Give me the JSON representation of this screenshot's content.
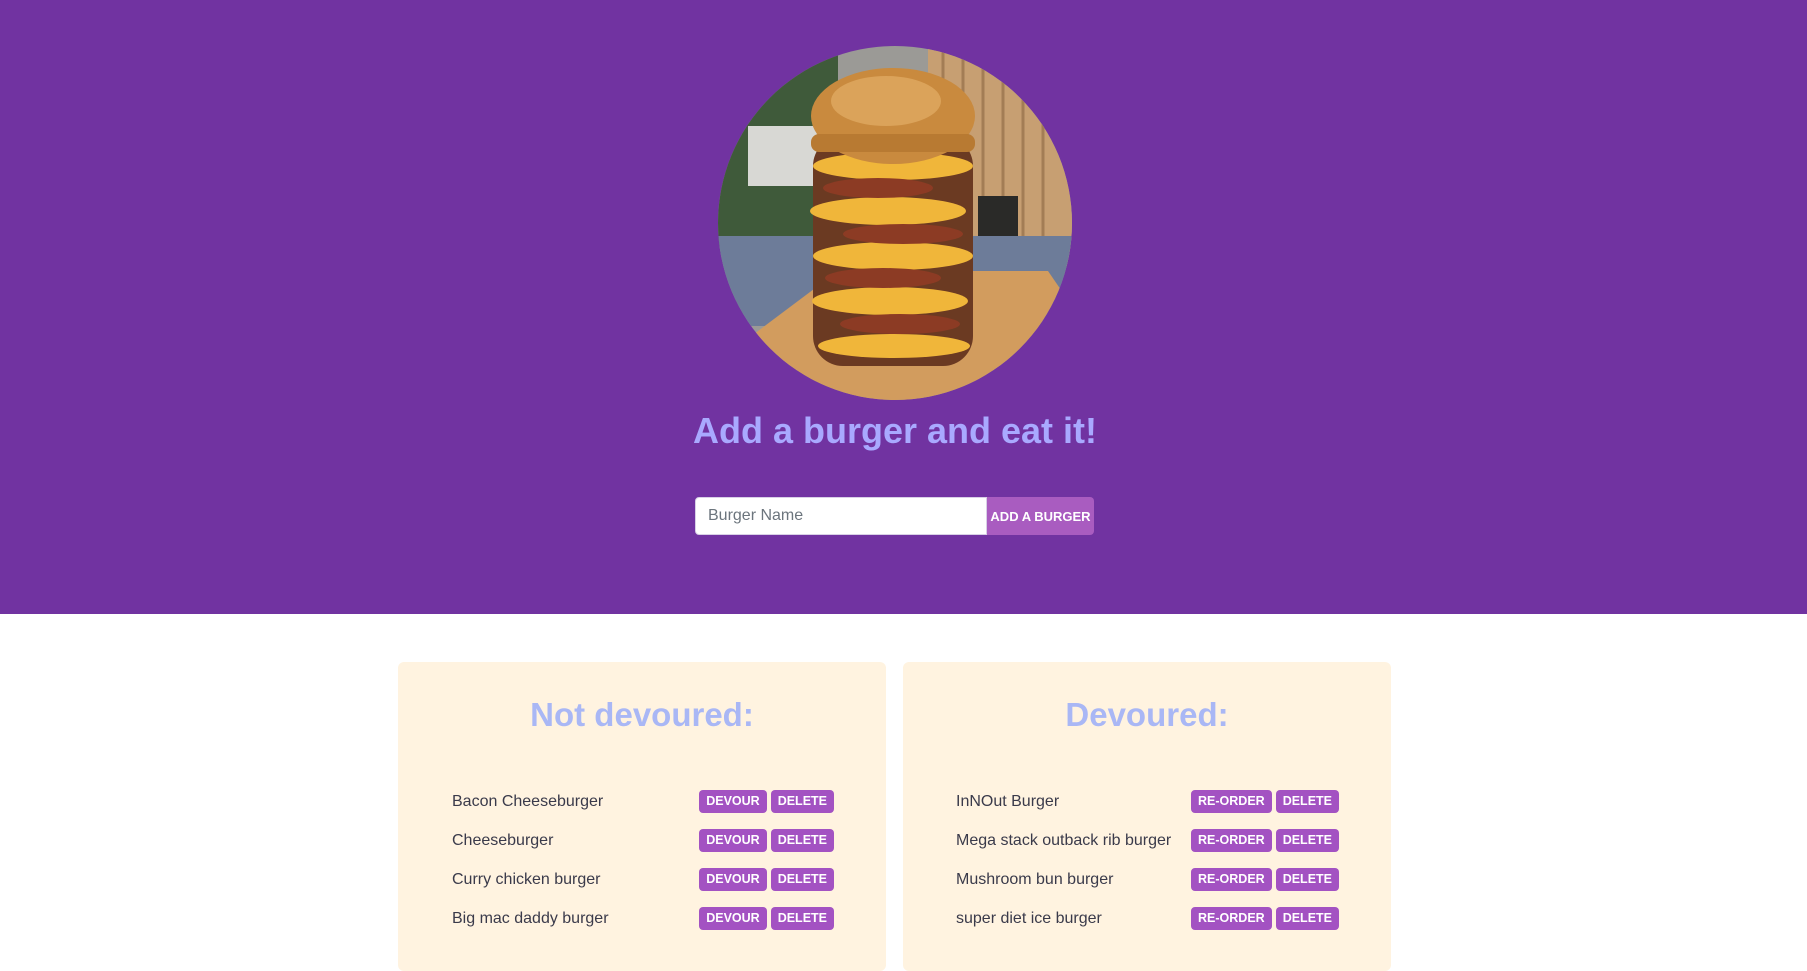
{
  "hero": {
    "headline": "Add a burger and eat it!",
    "input_placeholder": "Burger Name",
    "input_value": "",
    "add_button_label": "ADD A BURGER",
    "background_color": "#7133a1",
    "headline_color": "#a9a9ff"
  },
  "not_devoured": {
    "title": "Not devoured:",
    "devour_label": "DEVOUR",
    "delete_label": "DELETE",
    "items": [
      "Bacon Cheeseburger",
      "Cheeseburger",
      "Curry chicken burger",
      "Big mac daddy burger"
    ]
  },
  "devoured": {
    "title": "Devoured:",
    "reorder_label": "RE-ORDER",
    "delete_label": "DELETE",
    "items": [
      "InNOut Burger",
      "Mega stack outback rib burger",
      "Mushroom bun burger",
      "super diet ice burger"
    ]
  },
  "colors": {
    "button": "#a352c2",
    "panel": "#fff3e0",
    "panel_title": "#a9b7f5"
  }
}
